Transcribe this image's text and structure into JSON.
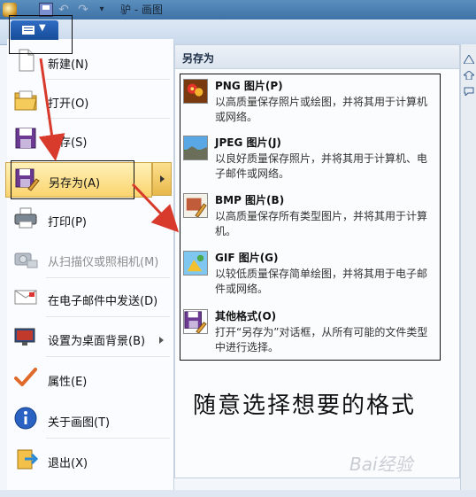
{
  "titlebar": {
    "title": "驴 - 画图"
  },
  "menu": {
    "items": [
      {
        "label": "新建(N)"
      },
      {
        "label": "打开(O)"
      },
      {
        "label": "保存(S)"
      },
      {
        "label": "另存为(A)"
      },
      {
        "label": "打印(P)"
      },
      {
        "label": "从扫描仪或照相机(M)"
      },
      {
        "label": "在电子邮件中发送(D)"
      },
      {
        "label": "设置为桌面背景(B)"
      },
      {
        "label": "属性(E)"
      },
      {
        "label": "关于画图(T)"
      },
      {
        "label": "退出(X)"
      }
    ]
  },
  "panel": {
    "heading": "另存为",
    "formats": [
      {
        "title": "PNG 图片(P)",
        "desc": "以高质量保存照片或绘图，并将其用于计算机或网络。"
      },
      {
        "title": "JPEG 图片(J)",
        "desc": "以良好质量保存照片，并将其用于计算机、电子邮件或网络。"
      },
      {
        "title": "BMP 图片(B)",
        "desc": "以高质量保存所有类型图片，并将其用于计算机。"
      },
      {
        "title": "GIF 图片(G)",
        "desc": "以较低质量保存简单绘图，并将其用于电子邮件或网络。"
      },
      {
        "title": "其他格式(O)",
        "desc": "打开“另存为”对话框，从所有可能的文件类型中进行选择。"
      }
    ]
  },
  "caption": "随意选择想要的格式",
  "watermark": "Bai经验",
  "colors": {
    "accent": "#d83a2c",
    "highlight": "#fbd46d",
    "app_button": "#1d5ab0"
  }
}
